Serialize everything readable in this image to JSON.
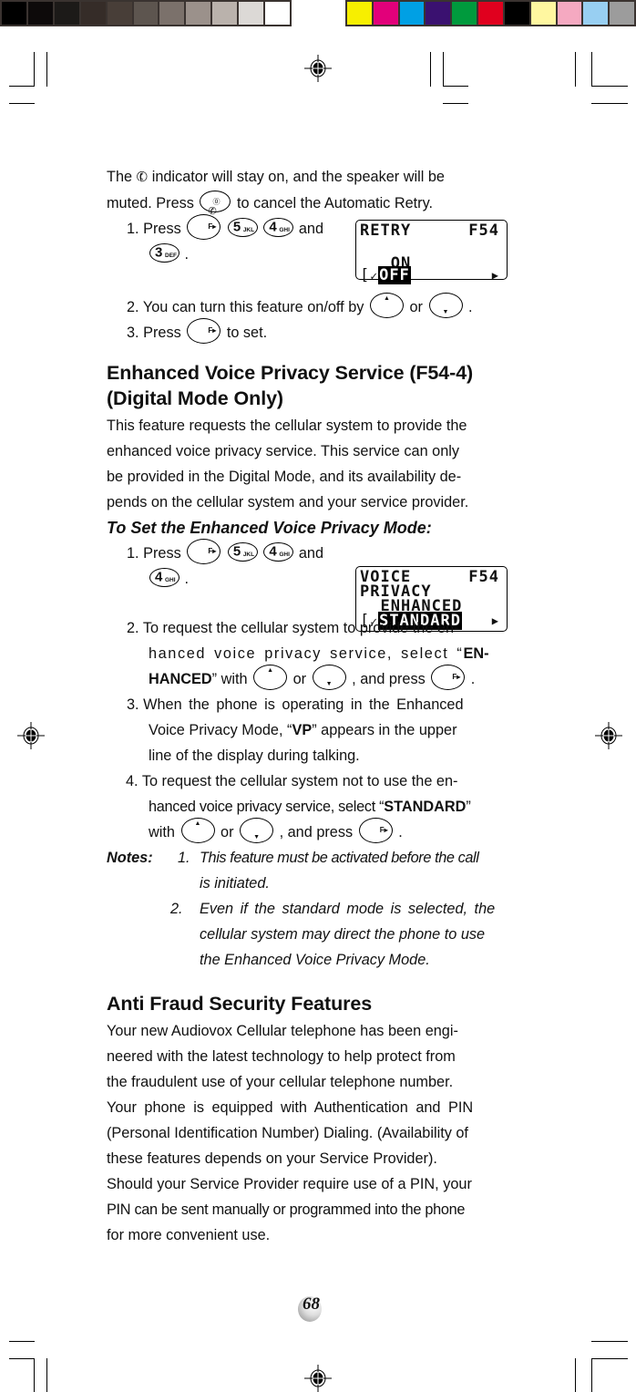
{
  "print_marks": {
    "gray_swatches": [
      "#000000",
      "#0d0a0a",
      "#1c1a18",
      "#352c28",
      "#483e38",
      "#5d554f",
      "#7b716b",
      "#9b918b",
      "#bab2ac",
      "#dcd9d6",
      "#ffffff"
    ],
    "color_swatches": [
      "#f7ef00",
      "#e2007a",
      "#00a0e4",
      "#3a1170",
      "#009a3d",
      "#e0001e",
      "#000000",
      "#fff7a0",
      "#f5a9c1",
      "#98cff2",
      "#9c9c9c"
    ]
  },
  "intro": {
    "line1_before": "The",
    "line1_after": "indicator will stay on, and the speaker will be",
    "line2_before": "muted. Press",
    "line2_after": "to cancel the Automatic Retry.",
    "handset_icon": "handset-icon",
    "end_key_icon": "end-power-key"
  },
  "retry_steps": [
    {
      "num": "1.",
      "before": "Press",
      "keys": [
        "F▸",
        "5 JKL",
        "4 GHI"
      ],
      "and": "and",
      "last_key": "3 DEF",
      "end": "."
    },
    {
      "num": "2.",
      "text": "You can turn this feature on/off by",
      "or": "or",
      "end": "."
    },
    {
      "num": "3.",
      "before": "Press",
      "after": "to set."
    }
  ],
  "keys": {
    "f": "F▸",
    "k5": {
      "num": "5",
      "letters": "JKL"
    },
    "k4": {
      "num": "4",
      "letters": "GHI"
    },
    "k3": {
      "num": "3",
      "letters": "DEF"
    },
    "up": "▲",
    "down": "▼",
    "handset": "☎",
    "power": "⓪"
  },
  "lcd_retry": {
    "title": "RETRY",
    "code": "F54",
    "opt1": "ON",
    "opt2_selected": "OFF",
    "bracket": "[",
    "check": "✓",
    "arrow": "▶"
  },
  "section_evp": {
    "heading_line1": "Enhanced Voice Privacy Service (F54-4)",
    "heading_line2": "(Digital Mode Only)",
    "body": [
      "This feature requests the cellular system to provide the",
      "enhanced voice privacy service. This service can only",
      "be provided in the Digital Mode, and its availability de-",
      "pends on the cellular system and your service provider."
    ],
    "subheading": "To Set the Enhanced Voice Privacy Mode:",
    "step1": {
      "num": "1.",
      "before": "Press",
      "and": "and",
      "end": "."
    },
    "step2": {
      "num": "2.",
      "line1": "To request the cellular system to provide the en-",
      "line2_a": "hanced voice privacy service, select “",
      "line2_bold": "EN-",
      "line3_bold": "HANCED",
      "line3_a": "” with",
      "or": "or",
      "line3_b": ", and press",
      "end": "."
    },
    "step3": {
      "num": "3.",
      "line1": "When the phone is operating in the Enhanced",
      "line2_a": "Voice Privacy Mode, “",
      "line2_bold": "VP",
      "line2_b": "” appears in the upper",
      "line3": "line of the display during talking."
    },
    "step4": {
      "num": "4.",
      "line1": "To request the cellular system not to use the en-",
      "line2_a": "hanced voice privacy service, select “",
      "line2_bold": "STANDARD",
      "line2_b": "”",
      "line3_a": "with",
      "or": "or",
      "line3_b": ", and press",
      "end": "."
    },
    "notes_label": "Notes:",
    "notes": [
      {
        "num": "1.",
        "line1": "This feature must be activated before the call",
        "line2": "is initiated."
      },
      {
        "num": "2.",
        "line1": "Even if the standard mode is selected, the",
        "line2": "cellular system may direct the phone to use",
        "line3": "the Enhanced Voice Privacy Mode."
      }
    ]
  },
  "lcd_voice": {
    "title": "VOICE",
    "code": "F54",
    "line2": "PRIVACY",
    "opt1": "ENHANCED",
    "opt2_selected": "STANDARD",
    "bracket": "[",
    "check": "✓",
    "arrow": "▶"
  },
  "section_anti": {
    "heading": "Anti Fraud Security Features",
    "para1": [
      "Your new Audiovox Cellular telephone has been engi-",
      "neered with the latest technology to help protect from",
      "the fraudulent use of your cellular telephone number."
    ],
    "para2": [
      "Your phone is equipped with Authentication and PIN",
      "(Personal Identification Number) Dialing. (Availability of",
      "these features depends on your Service Provider)."
    ],
    "para3": [
      "Should your Service Provider require use of a PIN, your",
      "PIN can be sent manually or programmed into the phone",
      "for more convenient use."
    ]
  },
  "page_number": "68"
}
